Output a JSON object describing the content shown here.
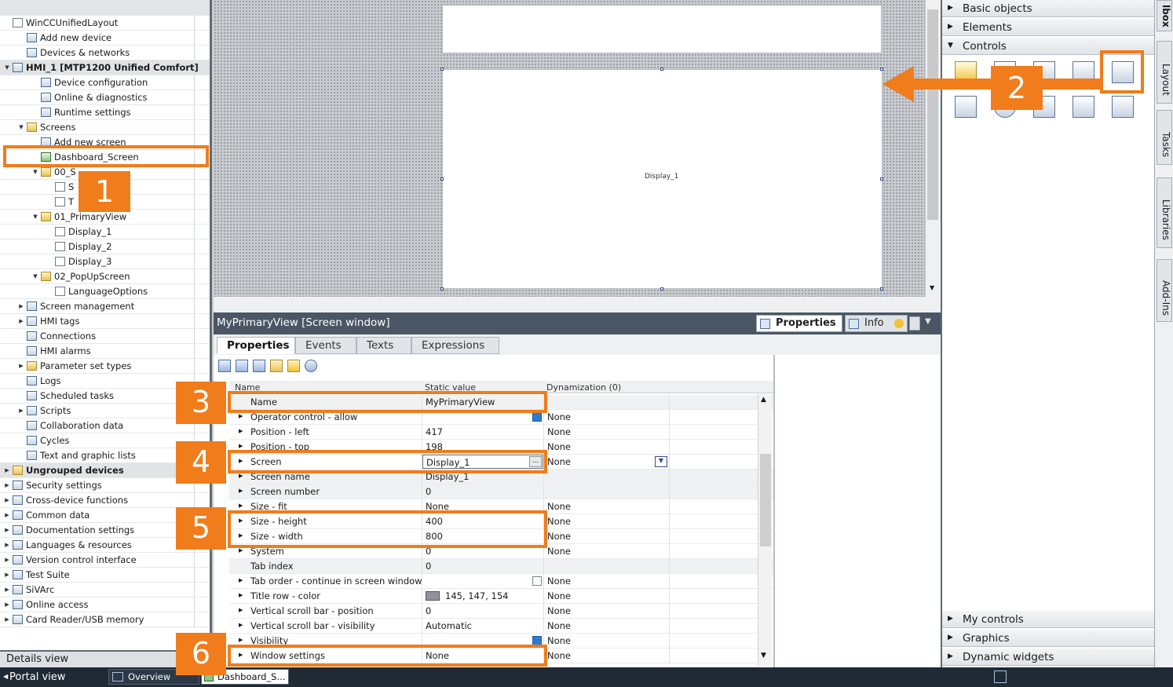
{
  "project_tree": {
    "items": [
      {
        "label": "WinCCUnifiedLayout",
        "icon": "project-icon"
      },
      {
        "label": "Add new device",
        "icon": "add-device-icon"
      },
      {
        "label": "Devices & networks",
        "icon": "network-icon"
      },
      {
        "label": "HMI_1 [MTP1200 Unified Comfort]",
        "icon": "hmi-device-icon"
      },
      {
        "label": "Device configuration",
        "icon": "device-config-icon"
      },
      {
        "label": "Online & diagnostics",
        "icon": "diagnostics-icon"
      },
      {
        "label": "Runtime settings",
        "icon": "runtime-settings-icon"
      },
      {
        "label": "Screens",
        "icon": "folder-icon"
      },
      {
        "label": "Add new screen",
        "icon": "add-screen-icon"
      },
      {
        "label": "Dashboard_Screen",
        "icon": "screen-icon"
      },
      {
        "label": "00_S",
        "icon": "folder-icon"
      },
      {
        "label": "S",
        "icon": "page-icon"
      },
      {
        "label": "T",
        "icon": "page-icon"
      },
      {
        "label": "01_PrimaryView",
        "icon": "folder-icon"
      },
      {
        "label": "Display_1",
        "icon": "page-icon"
      },
      {
        "label": "Display_2",
        "icon": "page-icon"
      },
      {
        "label": "Display_3",
        "icon": "page-icon"
      },
      {
        "label": "02_PopUpScreen",
        "icon": "folder-icon"
      },
      {
        "label": "LanguageOptions",
        "icon": "page-icon"
      },
      {
        "label": "Screen management",
        "icon": "screen-management-icon"
      },
      {
        "label": "HMI tags",
        "icon": "hmi-tags-icon"
      },
      {
        "label": "Connections",
        "icon": "connections-icon"
      },
      {
        "label": "HMI alarms",
        "icon": "alarms-icon"
      },
      {
        "label": "Parameter set types",
        "icon": "folder-icon"
      },
      {
        "label": "Logs",
        "icon": "logs-icon"
      },
      {
        "label": "Scheduled tasks",
        "icon": "scheduled-tasks-icon"
      },
      {
        "label": "Scripts",
        "icon": "scripts-icon"
      },
      {
        "label": "Collaboration data",
        "icon": "collaboration-icon"
      },
      {
        "label": "Cycles",
        "icon": "cycles-icon"
      },
      {
        "label": "Text and graphic lists",
        "icon": "text-lists-icon"
      },
      {
        "label": "Ungrouped devices",
        "icon": "folder-icon"
      },
      {
        "label": "Security settings",
        "icon": "security-icon"
      },
      {
        "label": "Cross-device functions",
        "icon": "cross-device-icon"
      },
      {
        "label": "Common data",
        "icon": "common-data-icon"
      },
      {
        "label": "Documentation settings",
        "icon": "documentation-icon"
      },
      {
        "label": "Languages & resources",
        "icon": "languages-icon"
      },
      {
        "label": "Version control interface",
        "icon": "version-control-icon"
      },
      {
        "label": "Test Suite",
        "icon": "test-suite-icon"
      },
      {
        "label": "SiVArc",
        "icon": "sivarc-icon"
      },
      {
        "label": "Online access",
        "icon": "online-access-icon"
      },
      {
        "label": "Card Reader/USB memory",
        "icon": "card-reader-icon"
      }
    ]
  },
  "details_view_label": "Details view",
  "canvas": {
    "display_label": "Display_1"
  },
  "inspector": {
    "title": "MyPrimaryView [Screen window]",
    "top_tabs": {
      "properties": "Properties",
      "info": "Info"
    },
    "tabs": [
      "Properties",
      "Events",
      "Texts",
      "Expressions"
    ],
    "columns": {
      "name": "Name",
      "static": "Static value",
      "dyn": "Dynamization (0)"
    },
    "rows": [
      {
        "name": "Name",
        "value": "MyPrimaryView",
        "dyn": ""
      },
      {
        "name": "Operator control - allow",
        "value": "",
        "dyn": "None"
      },
      {
        "name": "Position - left",
        "value": "417",
        "dyn": "None"
      },
      {
        "name": "Position - top",
        "value": "198",
        "dyn": "None"
      },
      {
        "name": "Screen",
        "value": "Display_1",
        "dyn": "None"
      },
      {
        "name": "Screen name",
        "value": "Display_1",
        "dyn": ""
      },
      {
        "name": "Screen number",
        "value": "0",
        "dyn": ""
      },
      {
        "name": "Size - fit",
        "value": "None",
        "dyn": "None"
      },
      {
        "name": "Size - height",
        "value": "400",
        "dyn": "None"
      },
      {
        "name": "Size - width",
        "value": "800",
        "dyn": "None"
      },
      {
        "name": "System",
        "value": "0",
        "dyn": "None"
      },
      {
        "name": "Tab index",
        "value": "0",
        "dyn": ""
      },
      {
        "name": "Tab order - continue in screen window",
        "value": "",
        "dyn": "None"
      },
      {
        "name": "Title row - color",
        "value": "145, 147, 154",
        "dyn": "None"
      },
      {
        "name": "Vertical scroll bar - position",
        "value": "0",
        "dyn": "None"
      },
      {
        "name": "Vertical scroll bar - visibility",
        "value": "Automatic",
        "dyn": "None"
      },
      {
        "name": "Visibility",
        "value": "",
        "dyn": "None"
      },
      {
        "name": "Window settings",
        "value": "None",
        "dyn": "None"
      }
    ]
  },
  "toolbox": {
    "sections_top": [
      "Basic objects",
      "Elements",
      "Controls"
    ],
    "sections_bottom": [
      "My controls",
      "Graphics",
      "Dynamic widgets"
    ]
  },
  "side_tabs": [
    "Layout",
    "Tasks",
    "Libraries",
    "Add-Ins"
  ],
  "side_tab_partial": "lbox",
  "statusbar": {
    "portal_view": "Portal view",
    "overview": "Overview",
    "editor_tab": "Dashboard_S..."
  },
  "callouts": [
    "1",
    "2",
    "3",
    "4",
    "5",
    "6"
  ],
  "colors": {
    "accent": "#f07c1b",
    "title_row": "#91939a"
  }
}
